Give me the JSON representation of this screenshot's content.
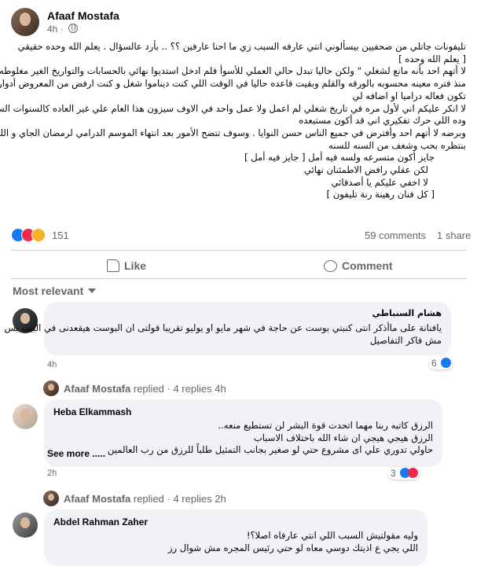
{
  "post": {
    "author": "Afaaf Mostafa",
    "time": "4h",
    "lines": [
      "تليفونات جاتلي من صحفيين بيسألوني انتي عارفه السبب زي ما احنا عارفين ؟؟ .. بأرد عالسؤال   .  يعلم الله وحده حقيقي",
      "[ يعلم الله وحده ]",
      "لا أتهم احد بأنه مانع لشغلي \"  ولكن حاليا تبدل حالي العملي للأسوأ  فلم ادخل استديوا نهائي بالحسابات والتواريخ الغير مغلوطه",
      "منذ فتره معينه محسوبه بالورقه والقلم  وبقيت قاعده حاليا  في الوقت اللي كنت ديناموا شغل و كنت  ارفض من المعروض أدوار لا",
      "تكون فعاله دراميا او اضافه لي",
      "لا انكر عليكم اني لأول مره في تاريخ شغلي  لم اعمل ولا عمل واحد في الاوف سيزون هذا العام  علي غير العاده كالسنوات السابقة",
      "وده اللي حرك  تفكيري  اني قد أكون  مستبعده",
      "وبرضه لا أتهم احد وأفترض في جميع الناس حسن النوايا .  وسوف  تتضح الأمور بعد انتهاء الموسم الدرامي لرمضان الجاي و اللي",
      "بنتظره بحب  وشغف من السنه للسنه",
      "جايز أكون متسرعه ولسه فيه أمل  [ جايز فيه أمل ]",
      "لكن عقلي رافض الاطمئنان نهائي",
      "لا اخفي عليكم يا أصدقائي",
      "[ كل فنان رهينة رنة تليفون ]"
    ],
    "reaction_count": "151",
    "comments_count": "59 comments",
    "shares_count": "1 share"
  },
  "actions": {
    "like": "Like",
    "comment": "Comment"
  },
  "sort_label": "Most relevant",
  "comments": [
    {
      "author": "هشام السنباطي",
      "lines": [
        "يافنانة على ماأذكر انتى كنبتي بوست عن حاجة في شهر مايو او يوليو تقريبا قولتى ان البوست هيقعدنى في البيت بس",
        "مش فاكر التفاصيل"
      ],
      "time": "4h",
      "reactions": "6"
    },
    {
      "author": "Heba Elkammash",
      "lines": [
        "الرزق كاتبه ربنا مهما اتحدت قوة البشر لن تستطيع منعه..",
        "الرزق هيجي هيجي ان شاء الله باختلاف الاسباب",
        "حاولي تدوري علي اى مشروع حتي لو صغير بجانب التمثيل طلباً للرزق من رب العالمين"
      ],
      "see_more": "See more .....",
      "time": "2h",
      "reactions": "3"
    },
    {
      "author": "Abdel Rahman Zaher",
      "lines": [
        "وليه مقولتيش السبب اللي انتي عارفاه اصلا؟!",
        "اللي يجي ع اذيتك دوسي معاه لو حتي رئيس المجره مش شوال رز"
      ]
    }
  ],
  "replies": [
    {
      "name": "Afaaf Mostafa",
      "label": "replied · 4 replies",
      "time": "4h"
    },
    {
      "name": "Afaaf Mostafa",
      "label": "replied · 4 replies",
      "time": "2h"
    }
  ]
}
